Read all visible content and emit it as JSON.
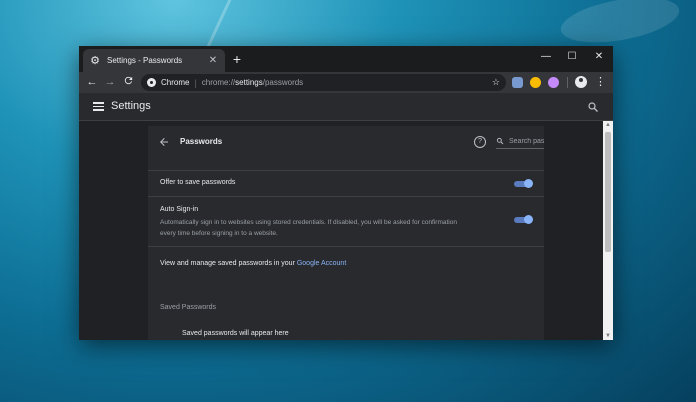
{
  "tab": {
    "title": "Settings - Passwords",
    "close": "✕",
    "new_tab": "+"
  },
  "window_controls": {
    "minimize": "—",
    "maximize": "☐",
    "close": "✕"
  },
  "toolbar": {
    "back": "←",
    "forward": "→",
    "reload": "C",
    "omnibox": {
      "chip": "Chrome",
      "sep": "|",
      "url_prefix": "chrome://",
      "url_host": "settings",
      "url_path": "/passwords"
    },
    "star": "☆",
    "menu": "⋮"
  },
  "settings": {
    "title": "Settings"
  },
  "passwords": {
    "title": "Passwords",
    "help": "?",
    "search_placeholder": "Search passwords",
    "offer_label": "Offer to save passwords",
    "offer_enabled": true,
    "auto_label": "Auto Sign-in",
    "auto_desc": "Automatically sign in to websites using stored credentials. If disabled, you will be asked for confirmation every time before signing in to a website.",
    "auto_enabled": true,
    "manage_text": "View and manage saved passwords in your ",
    "manage_link": "Google Account",
    "saved_title": "Saved Passwords",
    "saved_empty": "Saved passwords will appear here"
  },
  "scrollbar": {
    "up": "▲",
    "down": "▼"
  },
  "colors": {
    "toggle_on": "#8ab4f8",
    "link": "#8ab4f8",
    "surface": "#292a2d",
    "background": "#202124"
  }
}
